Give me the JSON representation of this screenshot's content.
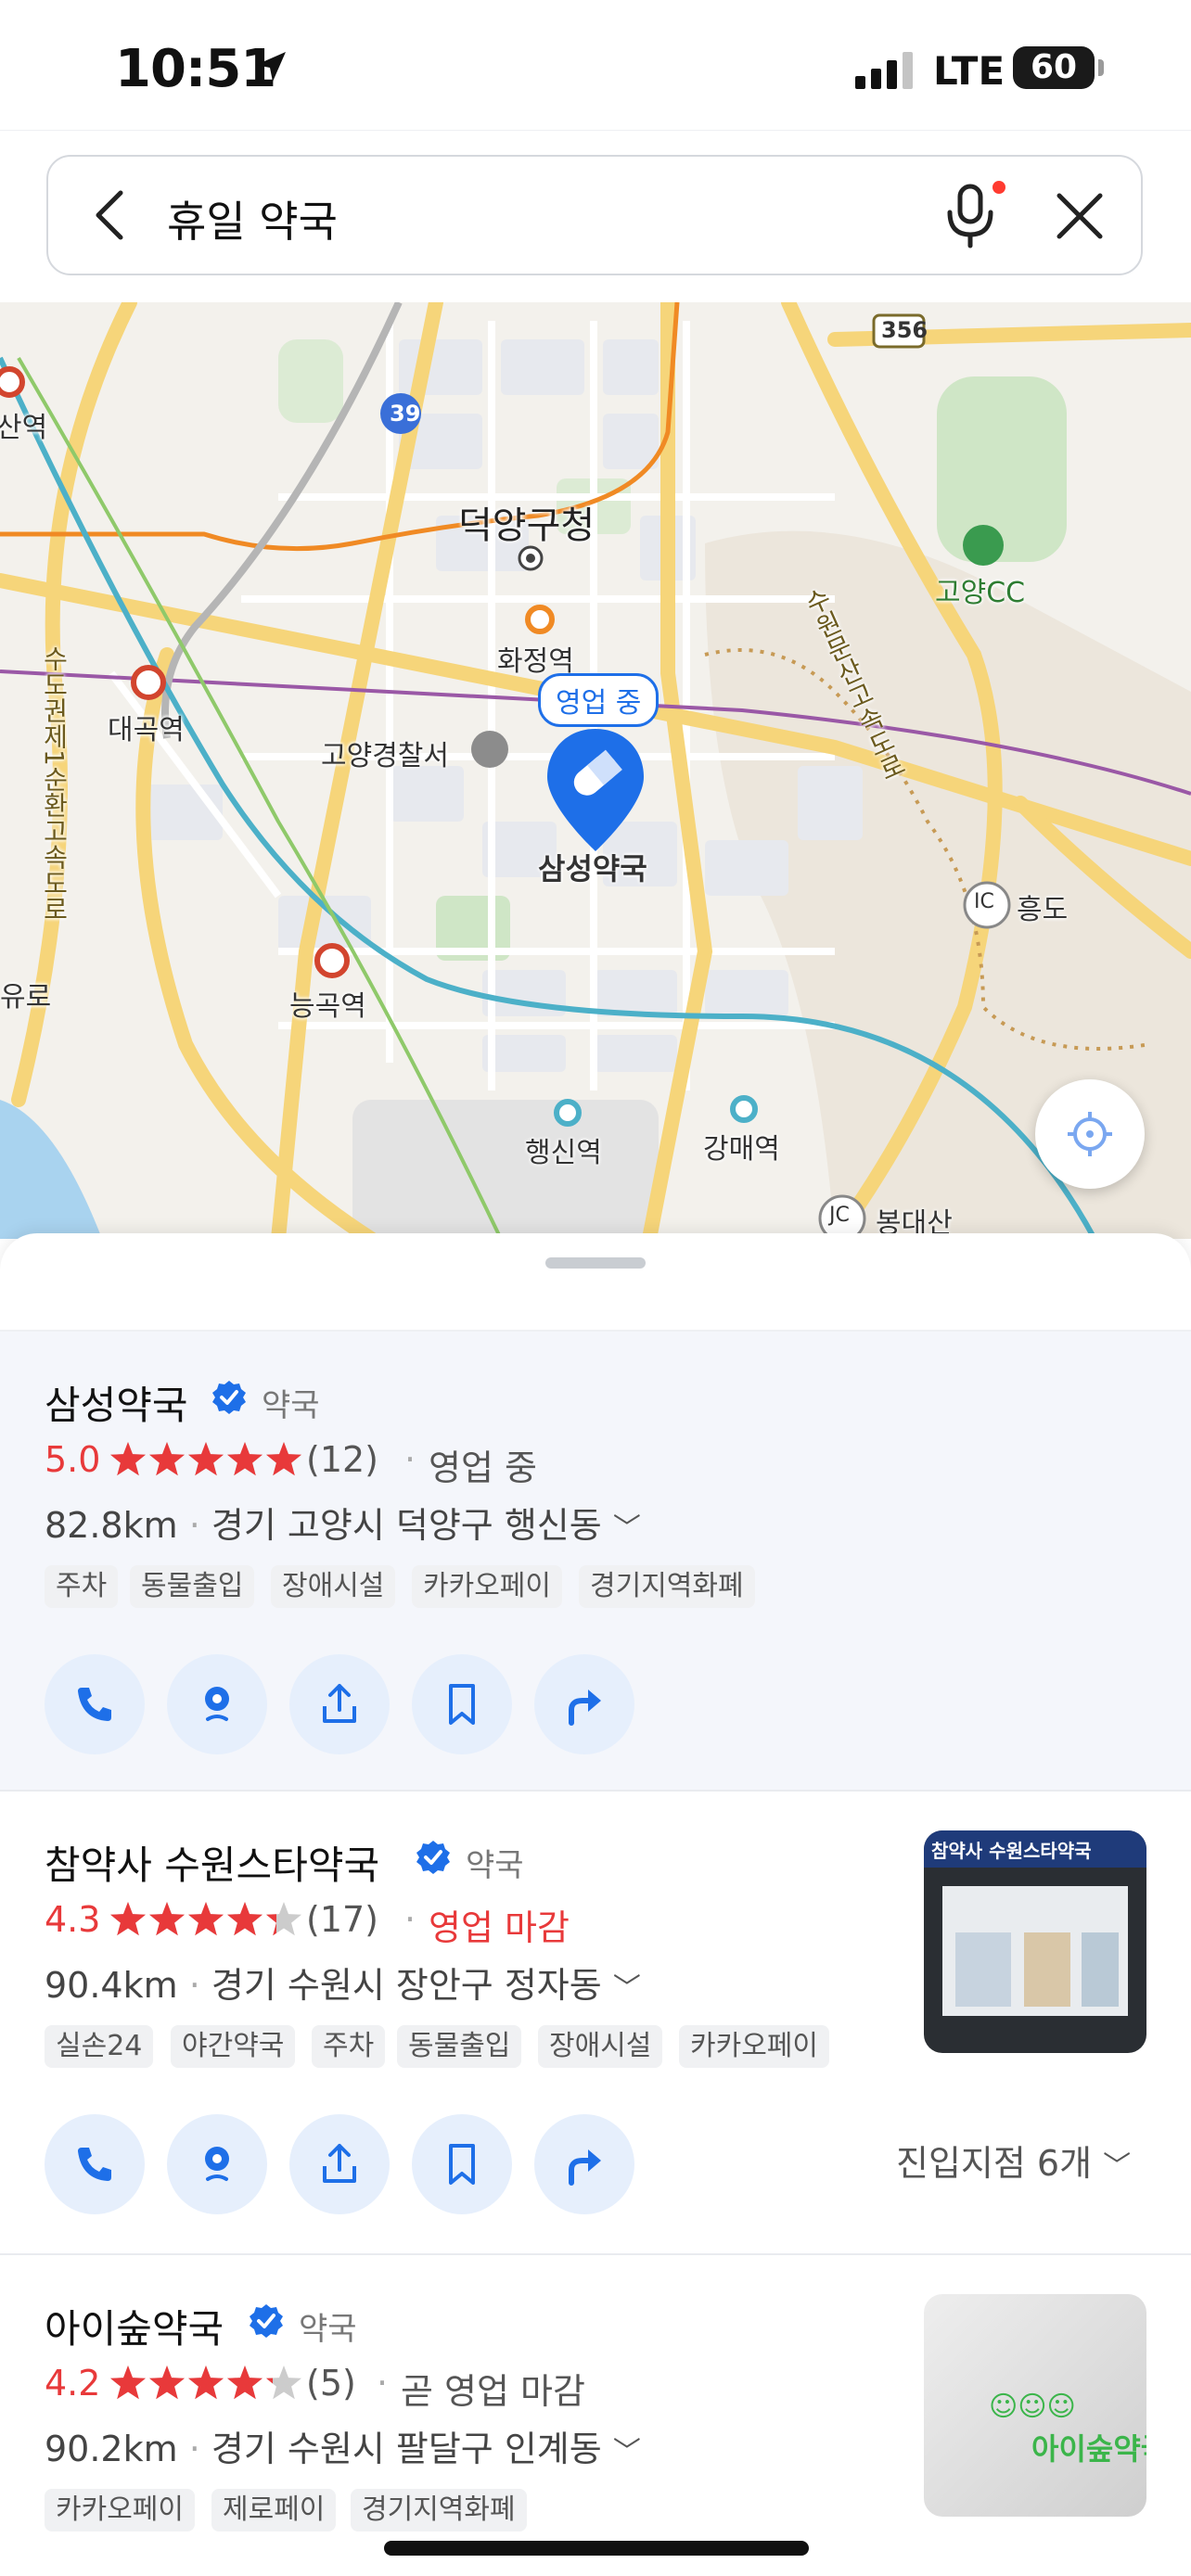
{
  "status_bar": {
    "time": "10:51",
    "network": "LTE",
    "battery": "60"
  },
  "search": {
    "query": "휴일 약국"
  },
  "map": {
    "labels": {
      "deokyang_office": "덕양구청",
      "hwajeong": "화정역",
      "daegok": "대곡역",
      "police": "고양경찰서",
      "pin_label": "삼성약국",
      "neunggok": "능곡역",
      "haengsin": "행신역",
      "gangmae": "강매역",
      "goyang_cc": "고양CC",
      "heungdo": "흥도",
      "heungdo_ic": "IC",
      "bongdaesan": "봉대산",
      "bongdaesan_jc": "JC",
      "san_station": "산역",
      "yuro": "유로",
      "route_39": "39",
      "route_356": "356",
      "expressway_left": "수도권제1순환고속도로",
      "expressway_right": "수원문산고속도로"
    },
    "open_badge": "영업 중"
  },
  "results": [
    {
      "name": "삼성약국",
      "category": "약국",
      "rating": "5.0",
      "stars": 5,
      "review_count": "(12)",
      "status": "영업 중",
      "distance": "82.8km",
      "address": "경기 고양시 덕양구 행신동",
      "tags": [
        "주차",
        "동물출입",
        "장애시설",
        "카카오페이",
        "경기지역화폐"
      ]
    },
    {
      "name": "참약사 수원스타약국",
      "category": "약국",
      "rating": "4.3",
      "stars": 4.3,
      "review_count": "(17)",
      "status": "영업 마감",
      "distance": "90.4km",
      "address": "경기 수원시 장안구 정자동",
      "tags": [
        "실손24",
        "야간약국",
        "주차",
        "동물출입",
        "장애시설",
        "카카오페이"
      ],
      "branches": "진입지점 6개",
      "thumb_text": "참약사 수원스타약국"
    },
    {
      "name": "아이숲약국",
      "category": "약국",
      "rating": "4.2",
      "stars": 4.2,
      "review_count": "(5)",
      "status": "곧 영업 마감",
      "distance": "90.2km",
      "address": "경기 수원시 팔달구 인계동",
      "tags": [
        "카카오페이",
        "제로페이",
        "경기지역화폐"
      ],
      "thumb_text": "아이숲약국"
    }
  ],
  "colors": {
    "accent": "#1e6fe8",
    "rating": "#e8393a",
    "action_bg": "#e6effc"
  }
}
